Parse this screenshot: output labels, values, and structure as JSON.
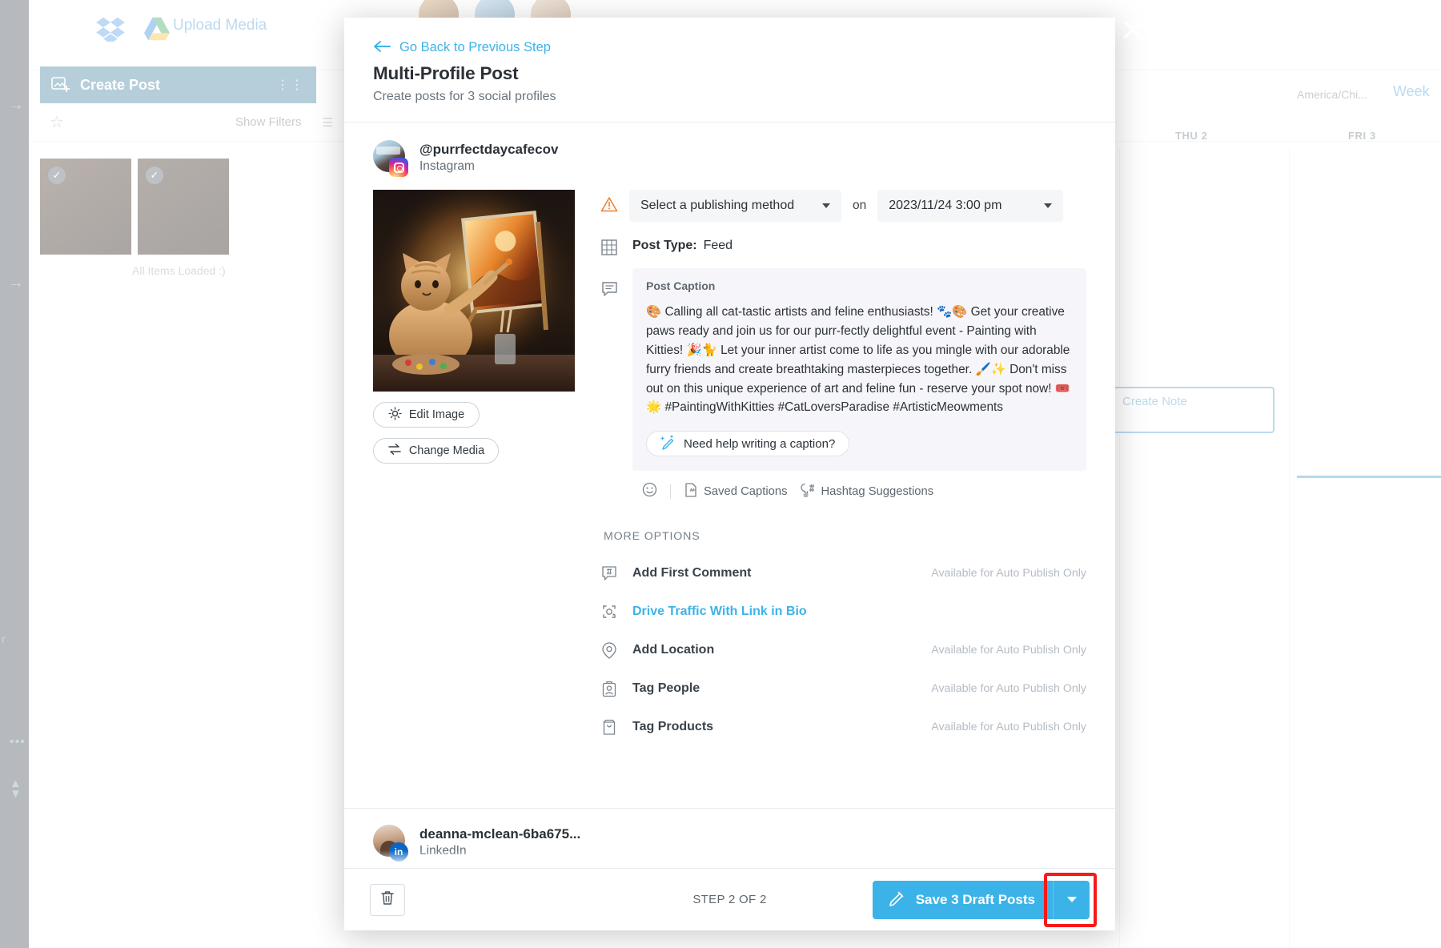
{
  "background": {
    "upload_media_label": "Upload Media",
    "create_post_label": "Create Post",
    "show_filters_label": "Show Filters",
    "all_items_loaded": "All Items Loaded :)",
    "timezone_label": "America/Chi...",
    "view_label": "Week",
    "columns": [
      "THU 2",
      "FRI 3"
    ],
    "create_note_label": "Create Note"
  },
  "modal": {
    "close_icon": "close-icon",
    "back_link": "Go Back to Previous Step",
    "back_arrow_icon": "arrow-left-icon",
    "title": "Multi-Profile Post",
    "subtitle": "Create posts for 3 social profiles"
  },
  "profile": {
    "handle": "@purrfectdaycafecov",
    "network": "Instagram",
    "network_icon": "instagram-icon",
    "avatar_icon": "avatar"
  },
  "media": {
    "preview_alt": "cat-painting-image",
    "edit_image_label": "Edit Image",
    "edit_image_icon": "magic-wand-icon",
    "change_media_label": "Change Media",
    "change_media_icon": "swap-icon"
  },
  "publishing": {
    "warning_icon": "warning-triangle-icon",
    "method_placeholder": "Select a publishing method",
    "method_value": "Select a publishing method",
    "dropdown_icon": "chevron-down-icon",
    "on_label": "on",
    "date_value": "2023/11/24 3:00 pm",
    "date_dropdown_icon": "chevron-down-icon"
  },
  "post_type": {
    "icon": "grid-icon",
    "label": "Post Type:",
    "value": "Feed"
  },
  "caption": {
    "icon": "comment-icon",
    "title": "Post Caption",
    "text": "🎨 Calling all cat-tastic artists and feline enthusiasts! 🐾🎨 Get your creative paws ready and join us for our purr-fectly delightful event - Painting with Kitties! 🎉🐈 Let your inner artist come to life as you mingle with our adorable furry friends and create breathtaking masterpieces together. 🖌️✨ Don't miss out on this unique experience of art and feline fun - reserve your spot now! 🎟️🌟 #PaintingWithKitties #CatLoversParadise #ArtisticMeowments",
    "helper_button": "Need help writing a caption?",
    "helper_icon": "magic-pen-icon",
    "tools": [
      {
        "label": "",
        "icon": "emoji-icon"
      },
      {
        "label": "Saved Captions",
        "icon": "saved-captions-icon"
      },
      {
        "label": "Hashtag Suggestions",
        "icon": "hashtag-bulb-icon"
      }
    ]
  },
  "more_options": {
    "heading": "MORE OPTIONS",
    "auto_publish_note": "Available for Auto Publish Only",
    "items": [
      {
        "label": "Add First Comment",
        "icon": "comment-hash-icon",
        "note": "Available for Auto Publish Only",
        "is_link": false
      },
      {
        "label": "Drive Traffic With Link in Bio",
        "icon": "link-in-bio-icon",
        "note": "",
        "is_link": true
      },
      {
        "label": "Add Location",
        "icon": "location-pin-icon",
        "note": "Available for Auto Publish Only",
        "is_link": false
      },
      {
        "label": "Tag People",
        "icon": "tag-people-icon",
        "note": "Available for Auto Publish Only",
        "is_link": false
      },
      {
        "label": "Tag Products",
        "icon": "tag-products-icon",
        "note": "Available for Auto Publish Only",
        "is_link": false
      }
    ]
  },
  "profile_peek": {
    "handle": "deanna-mclean-6ba675...",
    "network": "LinkedIn",
    "network_icon": "linkedin-icon",
    "badge_text": "in"
  },
  "footer": {
    "delete_icon": "trash-icon",
    "step_text": "STEP 2 OF 2",
    "save_label": "Save 3 Draft Posts",
    "save_icon": "pencil-icon",
    "save_caret_icon": "caret-down-icon"
  },
  "colors": {
    "accent": "#3cb3e8",
    "primary_text": "#2b3137",
    "muted_text": "#6b757e",
    "disabled_note": "#b4bcc4",
    "highlight": "#f81919",
    "caption_bg": "#f6f6fa",
    "field_bg": "#f4f6f8"
  }
}
